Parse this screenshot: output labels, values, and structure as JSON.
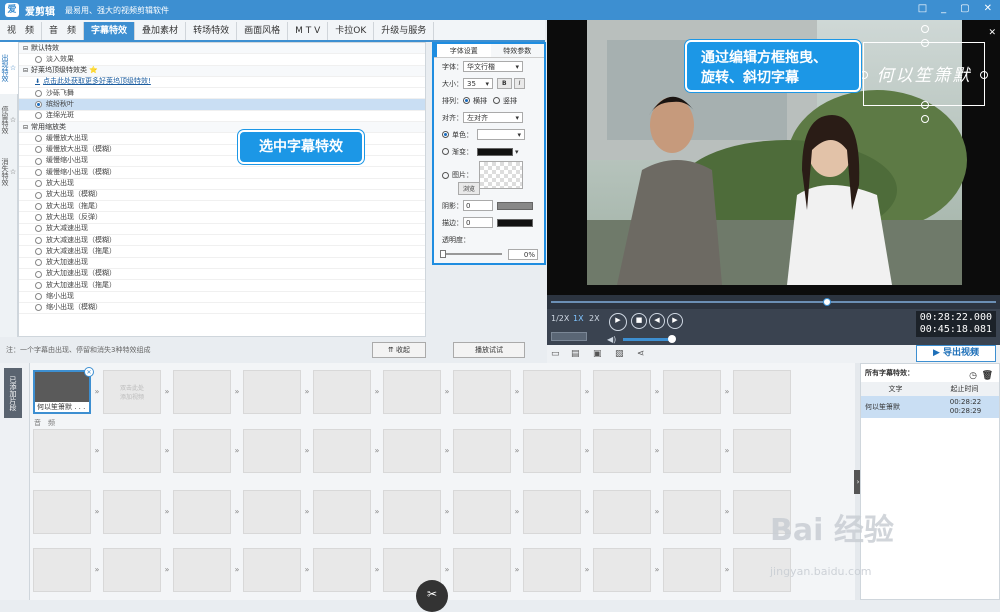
{
  "app": {
    "name": "爱剪辑",
    "slogan": "最易用、强大的视频剪辑软件",
    "logo": "爱",
    "win_buttons": [
      "□",
      "_",
      "▢",
      "✕"
    ]
  },
  "tabs": [
    "视　频",
    "音　频",
    "字幕特效",
    "叠加素材",
    "转场特效",
    "画面风格",
    "M T V",
    "卡拉OK",
    "升级与服务"
  ],
  "side_tabs": [
    "出现特效",
    "停留特效",
    "消失特效"
  ],
  "effects": [
    {
      "t": "默认特效",
      "k": "cat"
    },
    {
      "t": "淡入效果",
      "k": "item"
    },
    {
      "t": "好莱坞顶级特效类 ⭐",
      "k": "cat"
    },
    {
      "t": "点击此处获取更多好莱坞顶级特效!",
      "k": "link"
    },
    {
      "t": "沙砾飞舞",
      "k": "item"
    },
    {
      "t": "缤纷秋叶",
      "k": "sel"
    },
    {
      "t": "连绵光斑",
      "k": "item"
    },
    {
      "t": "常用缩放类",
      "k": "cat"
    },
    {
      "t": "缓慢放大出现",
      "k": "item"
    },
    {
      "t": "缓慢放大出现（模糊）",
      "k": "item"
    },
    {
      "t": "缓慢缩小出现",
      "k": "item"
    },
    {
      "t": "缓慢缩小出现（模糊）",
      "k": "item"
    },
    {
      "t": "放大出现",
      "k": "item"
    },
    {
      "t": "放大出现（模糊）",
      "k": "item"
    },
    {
      "t": "放大出现（拖尾）",
      "k": "item"
    },
    {
      "t": "放大出现（反弹）",
      "k": "item"
    },
    {
      "t": "放大减速出现",
      "k": "item"
    },
    {
      "t": "放大减速出现（模糊）",
      "k": "item"
    },
    {
      "t": "放大减速出现（拖尾）",
      "k": "item"
    },
    {
      "t": "放大加速出现",
      "k": "item"
    },
    {
      "t": "放大加速出现（模糊）",
      "k": "item"
    },
    {
      "t": "放大加速出现（拖尾）",
      "k": "item"
    },
    {
      "t": "缩小出现",
      "k": "item"
    },
    {
      "t": "缩小出现（模糊）",
      "k": "item"
    }
  ],
  "font_panel": {
    "tabs": [
      "字体设置",
      "特效参数"
    ],
    "font_label": "字体：",
    "font_value": "华文行楷",
    "size_label": "大小：",
    "size_value": "35",
    "bold": "B",
    "italic": "I",
    "layout_label": "排列：",
    "layout_h": "横排",
    "layout_v": "竖排",
    "align_label": "对齐：",
    "align_value": "左对齐",
    "solid_label": "单色：",
    "gradient_label": "渐变：",
    "image_label": "图片：",
    "browse": "浏览",
    "shadow_label": "阴影：",
    "shadow_value": "0",
    "stroke_label": "描边：",
    "stroke_value": "0",
    "opacity_label": "透明度：",
    "opacity_value": "0%"
  },
  "note": "注：一个字幕由出现、停留和消失3种特效组成",
  "collapse_btn": "收起",
  "preview_btn": "播放试试",
  "subtitle_text": "何以笙箫默",
  "callouts": {
    "select": "选中字幕特效",
    "drag": "通过编辑方框拖曳、\n旋转、斜切字幕"
  },
  "player": {
    "speeds": [
      "1/2X",
      "1X",
      "2X"
    ],
    "time_current": "00:28:22.000",
    "time_total": "00:45:18.081",
    "progress_fraction": 0.62
  },
  "export_btn": "导出视频",
  "added_tab": "已添加片段",
  "timeline": {
    "clip_name": "何以笙箫默 . . .",
    "empty_hint": "双击此处\n添加视频",
    "audio_label": "音　频"
  },
  "right_panel": {
    "title": "所有字幕特效：",
    "col_text": "文字",
    "col_time": "起止时间",
    "row_text": "何以笙箫默",
    "row_start": "00:28:22",
    "row_end": "00:28:29"
  },
  "watermark": {
    "logo": "Bai 经验",
    "url": "jingyan.baidu.com"
  }
}
